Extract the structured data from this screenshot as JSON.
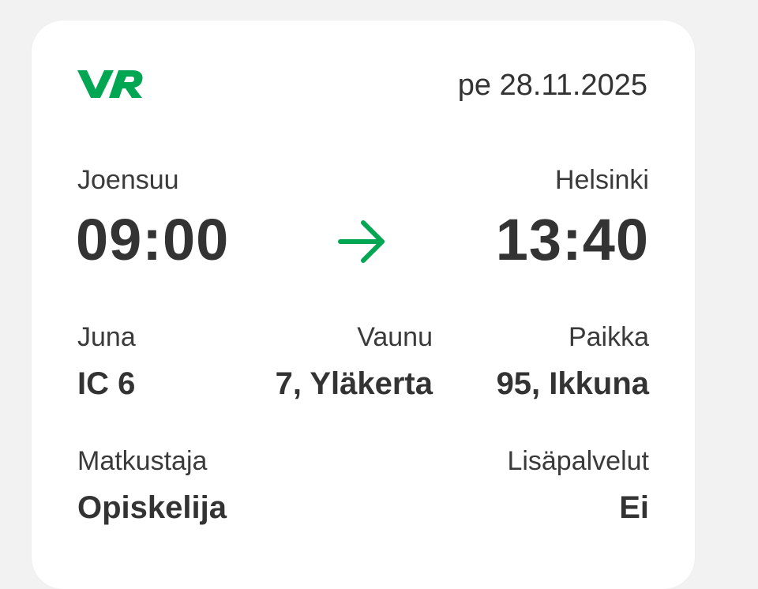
{
  "ticket": {
    "brand_logo": "VR",
    "date": "pe 28.11.2025",
    "origin": {
      "station": "Joensuu",
      "time": "09:00"
    },
    "destination": {
      "station": "Helsinki",
      "time": "13:40"
    },
    "arrow_icon": "arrow-right-icon",
    "details": {
      "train_label": "Juna",
      "train_value": "IC 6",
      "car_label": "Vaunu",
      "car_value": "7, Yläkerta",
      "seat_label": "Paikka",
      "seat_value": "95, Ikkuna",
      "passenger_label": "Matkustaja",
      "passenger_value": "Opiskelija",
      "extras_label": "Lisäpalvelut",
      "extras_value": "Ei"
    }
  },
  "colors": {
    "brand_green": "#00A651",
    "text": "#333333",
    "card_bg": "#ffffff",
    "page_bg": "#f2f2f2"
  }
}
